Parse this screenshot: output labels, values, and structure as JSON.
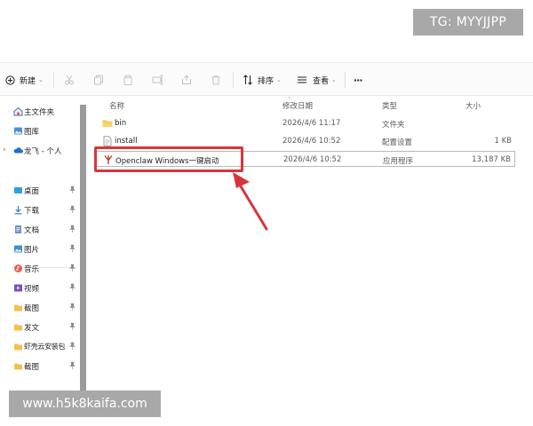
{
  "watermarks": {
    "top": "TG: MYYJJPP",
    "bottom": "www.h5k8kaifa.com"
  },
  "toolbar": {
    "new_label": "新建",
    "sort_label": "排序",
    "view_label": "查看",
    "more_label": "···"
  },
  "sidebar": {
    "home": "主文件夹",
    "gallery": "图库",
    "onedrive": "龙飞 - 个人",
    "items": [
      {
        "label": "桌面",
        "icon": "desktop-icon"
      },
      {
        "label": "下载",
        "icon": "download-icon"
      },
      {
        "label": "文档",
        "icon": "document-icon"
      },
      {
        "label": "图片",
        "icon": "picture-icon"
      },
      {
        "label": "音乐",
        "icon": "music-icon"
      },
      {
        "label": "视频",
        "icon": "video-icon"
      },
      {
        "label": "截图",
        "icon": "folder-icon"
      },
      {
        "label": "发文",
        "icon": "folder-icon"
      },
      {
        "label": "虾壳云安装包",
        "icon": "folder-icon"
      },
      {
        "label": "截图",
        "icon": "folder-icon"
      }
    ]
  },
  "columns": {
    "name": "名称",
    "modified": "修改日期",
    "type": "类型",
    "size": "大小"
  },
  "files": [
    {
      "name": "bin",
      "modified": "2026/4/6 11:17",
      "type": "文件夹",
      "size": ""
    },
    {
      "name": "install",
      "modified": "2026/4/6 10:52",
      "type": "配置设置",
      "size": "1 KB"
    },
    {
      "name": "Openclaw Windows一键启动",
      "modified": "2026/4/6 10:52",
      "type": "应用程序",
      "size": "13,187 KB"
    }
  ],
  "colors": {
    "highlight": "#d9343a",
    "arrow": "#d9343a",
    "folder": "#f2c14e"
  }
}
